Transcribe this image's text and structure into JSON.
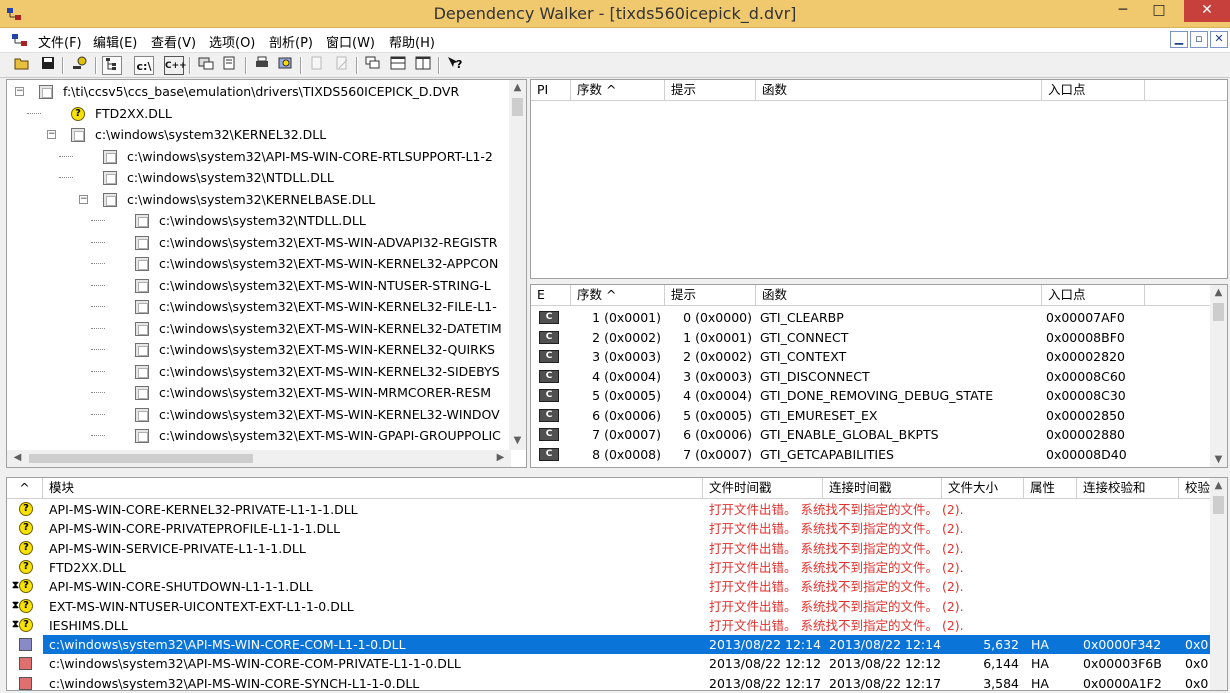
{
  "window": {
    "title": "Dependency Walker - [tixds560icepick_d.dvr]",
    "minimize": "─",
    "maximize": "□",
    "close": "✕"
  },
  "menu": {
    "items": [
      "文件(F)",
      "编辑(E)",
      "查看(V)",
      "选项(O)",
      "剖析(P)",
      "窗口(W)",
      "帮助(H)"
    ],
    "mdi_buttons": [
      "▁",
      "▫",
      "✕"
    ]
  },
  "toolbar": {
    "buttons": [
      "open-icon",
      "save-icon",
      "find-icon",
      "tree-toggle-icon",
      "c-button",
      "cpp-button",
      "dep-icon",
      "props-icon",
      "print-icon",
      "search-icon",
      "copy-icon",
      "paste-icon",
      "cascade-icon",
      "tile-h-icon",
      "tile-v-icon",
      "help-icon"
    ],
    "c_label": "c:\\",
    "cpp_label": "C++"
  },
  "tree": {
    "items": [
      {
        "level": 0,
        "expander": "−",
        "icon": "box",
        "label": "f:\\ti\\ccsv5\\ccs_base\\emulation\\drivers\\TIXDS560ICEPICK_D.DVR"
      },
      {
        "level": 1,
        "expander": "",
        "icon": "q",
        "label": "FTD2XX.DLL"
      },
      {
        "level": 1,
        "expander": "−",
        "icon": "box",
        "label": "c:\\windows\\system32\\KERNEL32.DLL"
      },
      {
        "level": 2,
        "expander": "",
        "icon": "box",
        "label": "c:\\windows\\system32\\API-MS-WIN-CORE-RTLSUPPORT-L1-2"
      },
      {
        "level": 2,
        "expander": "",
        "icon": "box",
        "label": "c:\\windows\\system32\\NTDLL.DLL"
      },
      {
        "level": 2,
        "expander": "−",
        "icon": "box",
        "label": "c:\\windows\\system32\\KERNELBASE.DLL"
      },
      {
        "level": 3,
        "expander": "",
        "icon": "box",
        "label": "c:\\windows\\system32\\NTDLL.DLL"
      },
      {
        "level": 3,
        "expander": "",
        "icon": "box",
        "label": "c:\\windows\\system32\\EXT-MS-WIN-ADVAPI32-REGISTR"
      },
      {
        "level": 3,
        "expander": "",
        "icon": "box",
        "label": "c:\\windows\\system32\\EXT-MS-WIN-KERNEL32-APPCON"
      },
      {
        "level": 3,
        "expander": "",
        "icon": "box",
        "label": "c:\\windows\\system32\\EXT-MS-WIN-NTUSER-STRING-L"
      },
      {
        "level": 3,
        "expander": "",
        "icon": "box",
        "label": "c:\\windows\\system32\\EXT-MS-WIN-KERNEL32-FILE-L1-"
      },
      {
        "level": 3,
        "expander": "",
        "icon": "box",
        "label": "c:\\windows\\system32\\EXT-MS-WIN-KERNEL32-DATETIM"
      },
      {
        "level": 3,
        "expander": "",
        "icon": "box",
        "label": "c:\\windows\\system32\\EXT-MS-WIN-KERNEL32-QUIRKS"
      },
      {
        "level": 3,
        "expander": "",
        "icon": "box",
        "label": "c:\\windows\\system32\\EXT-MS-WIN-KERNEL32-SIDEBYS"
      },
      {
        "level": 3,
        "expander": "",
        "icon": "box",
        "label": "c:\\windows\\system32\\EXT-MS-WIN-MRMCORER-RESM"
      },
      {
        "level": 3,
        "expander": "",
        "icon": "box",
        "label": "c:\\windows\\system32\\EXT-MS-WIN-KERNEL32-WINDOV"
      },
      {
        "level": 3,
        "expander": "",
        "icon": "box",
        "label": "c:\\windows\\system32\\EXT-MS-WIN-GPAPI-GROUPPOLIC"
      }
    ]
  },
  "imports": {
    "headers": [
      "PI",
      "序数 ^",
      "提示",
      "函数",
      "入口点"
    ]
  },
  "exports": {
    "headers": [
      "E",
      "序数 ^",
      "提示",
      "函数",
      "入口点"
    ],
    "icon_label": "C",
    "rows": [
      {
        "ordinal": "1 (0x0001)",
        "hint": "0 (0x0000)",
        "func": "GTI_CLEARBP",
        "entry": "0x00007AF0"
      },
      {
        "ordinal": "2 (0x0002)",
        "hint": "1 (0x0001)",
        "func": "GTI_CONNECT",
        "entry": "0x00008BF0"
      },
      {
        "ordinal": "3 (0x0003)",
        "hint": "2 (0x0002)",
        "func": "GTI_CONTEXT",
        "entry": "0x00002820"
      },
      {
        "ordinal": "4 (0x0004)",
        "hint": "3 (0x0003)",
        "func": "GTI_DISCONNECT",
        "entry": "0x00008C60"
      },
      {
        "ordinal": "5 (0x0005)",
        "hint": "4 (0x0004)",
        "func": "GTI_DONE_REMOVING_DEBUG_STATE",
        "entry": "0x00008C30"
      },
      {
        "ordinal": "6 (0x0006)",
        "hint": "5 (0x0005)",
        "func": "GTI_EMURESET_EX",
        "entry": "0x00002850"
      },
      {
        "ordinal": "7 (0x0007)",
        "hint": "6 (0x0006)",
        "func": "GTI_ENABLE_GLOBAL_BKPTS",
        "entry": "0x00002880"
      },
      {
        "ordinal": "8 (0x0008)",
        "hint": "7 (0x0007)",
        "func": "GTI_GETCAPABILITIES",
        "entry": "0x00008D40"
      }
    ]
  },
  "modules": {
    "headers": [
      "^",
      "模块",
      "文件时间戳",
      "连接时间戳",
      "文件大小",
      "属性",
      "连接校验和",
      "校验"
    ],
    "error_text": "打开文件出错。 系统找不到指定的文件。 (2).",
    "rows": [
      {
        "icon": "q",
        "name": "API-MS-WIN-CORE-KERNEL32-PRIVATE-L1-1-1.DLL",
        "error": true
      },
      {
        "icon": "q",
        "name": "API-MS-WIN-CORE-PRIVATEPROFILE-L1-1-1.DLL",
        "error": true
      },
      {
        "icon": "q",
        "name": "API-MS-WIN-SERVICE-PRIVATE-L1-1-1.DLL",
        "error": true
      },
      {
        "icon": "q",
        "name": "FTD2XX.DLL",
        "error": true
      },
      {
        "icon": "qh",
        "name": "API-MS-WIN-CORE-SHUTDOWN-L1-1-1.DLL",
        "error": true
      },
      {
        "icon": "qh",
        "name": "EXT-MS-WIN-NTUSER-UICONTEXT-EXT-L1-1-0.DLL",
        "error": true
      },
      {
        "icon": "qh",
        "name": "IESHIMS.DLL",
        "error": true
      },
      {
        "icon": "blue",
        "name": "c:\\windows\\system32\\API-MS-WIN-CORE-COM-L1-1-0.DLL",
        "error": false,
        "file_ts": "2013/08/22 12:14",
        "link_ts": "2013/08/22 12:14",
        "size": "5,632",
        "attr": "HA",
        "checksum": "0x0000F342",
        "cs2": "0x0",
        "selected": true
      },
      {
        "icon": "red",
        "name": "c:\\windows\\system32\\API-MS-WIN-CORE-COM-PRIVATE-L1-1-0.DLL",
        "error": false,
        "file_ts": "2013/08/22 12:12",
        "link_ts": "2013/08/22 12:12",
        "size": "6,144",
        "attr": "HA",
        "checksum": "0x00003F6B",
        "cs2": "0x0"
      },
      {
        "icon": "red",
        "name": "c:\\windows\\system32\\API-MS-WIN-CORE-SYNCH-L1-1-0.DLL",
        "error": false,
        "file_ts": "2013/08/22 12:17",
        "link_ts": "2013/08/22 12:17",
        "size": "3,584",
        "attr": "HA",
        "checksum": "0x0000A1F2",
        "cs2": "0x0"
      }
    ]
  }
}
